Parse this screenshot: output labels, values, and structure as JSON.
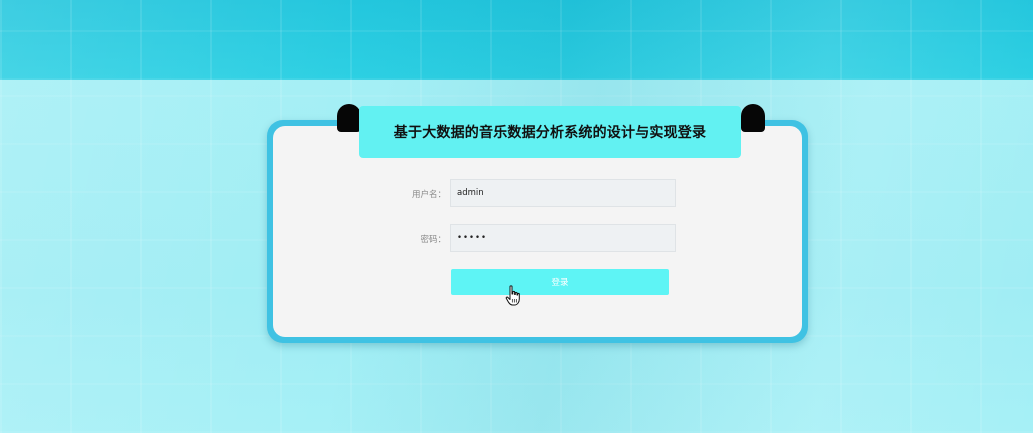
{
  "page": {
    "title": "基于大数据的音乐数据分析系统的设计与实现登录"
  },
  "form": {
    "username_label": "用户名：",
    "username_value": "admin",
    "password_label": "密码：",
    "password_value": "•••••",
    "login_label": "登录"
  },
  "colors": {
    "banner": "#62f1f2",
    "card_border": "#3fc2e3",
    "button": "#5ef4f5",
    "background": "#a6f0f6"
  },
  "icons": {
    "cursor": "hand-pointer-icon"
  }
}
